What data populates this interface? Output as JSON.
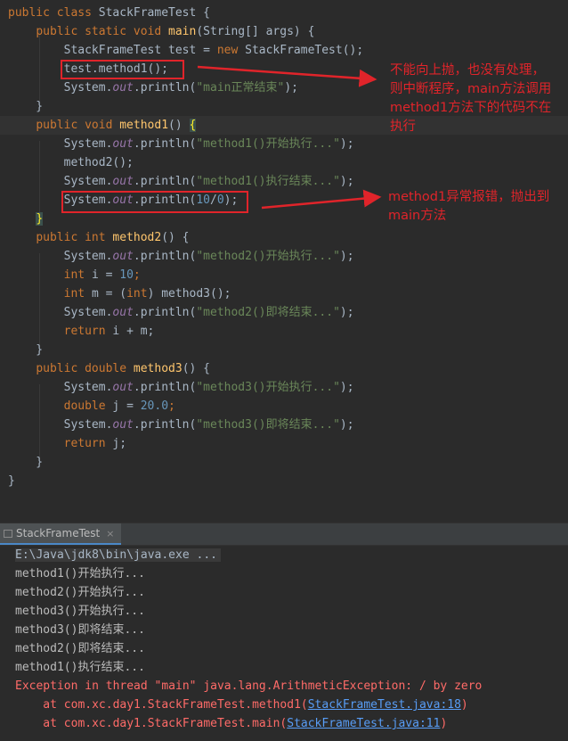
{
  "editor": {
    "lines": [
      [
        [
          "kw",
          "public class "
        ],
        [
          "",
          "StackFrameTest {"
        ]
      ],
      [
        [
          "",
          "    "
        ],
        [
          "kw",
          "public static void "
        ],
        [
          "fn",
          "main"
        ],
        [
          "",
          "(String[] args) {"
        ]
      ],
      [
        [
          "",
          "        StackFrameTest test = "
        ],
        [
          "kw",
          "new "
        ],
        [
          "",
          "StackFrameTest();"
        ]
      ],
      [
        [
          "",
          "        test.method1();"
        ]
      ],
      [
        [
          "",
          "        System."
        ],
        [
          "fld",
          "out"
        ],
        [
          "",
          ".println("
        ],
        [
          "str",
          "\"main正常结束\""
        ],
        [
          "",
          ");"
        ]
      ],
      [
        [
          "",
          "    }"
        ]
      ],
      [
        [
          "",
          "    "
        ],
        [
          "kw",
          "public void "
        ],
        [
          "fn",
          "method1"
        ],
        [
          "",
          "() "
        ],
        [
          "brm",
          "{"
        ]
      ],
      [
        [
          "",
          "        System."
        ],
        [
          "fld",
          "out"
        ],
        [
          "",
          ".println("
        ],
        [
          "str",
          "\"method1()开始执行...\""
        ],
        [
          "",
          ");"
        ]
      ],
      [
        [
          "",
          "        method2();"
        ]
      ],
      [
        [
          "",
          "        System."
        ],
        [
          "fld",
          "out"
        ],
        [
          "",
          ".println("
        ],
        [
          "str",
          "\"method1()执行结束...\""
        ],
        [
          "",
          ");"
        ]
      ],
      [
        [
          "",
          "        System."
        ],
        [
          "fld",
          "out"
        ],
        [
          "",
          ".println("
        ],
        [
          "num",
          "10"
        ],
        [
          "",
          "/"
        ],
        [
          "num",
          "0"
        ],
        [
          "",
          ");"
        ]
      ],
      [
        [
          "",
          "    "
        ],
        [
          "brm",
          "}"
        ]
      ],
      [
        [
          "",
          "    "
        ],
        [
          "kw",
          "public int "
        ],
        [
          "fn",
          "method2"
        ],
        [
          "",
          "() {"
        ]
      ],
      [
        [
          "",
          "        System."
        ],
        [
          "fld",
          "out"
        ],
        [
          "",
          ".println("
        ],
        [
          "str",
          "\"method2()开始执行...\""
        ],
        [
          "",
          ");"
        ]
      ],
      [
        [
          "",
          "        "
        ],
        [
          "kw",
          "int "
        ],
        [
          "",
          "i = "
        ],
        [
          "num",
          "10"
        ],
        [
          "kw",
          ";"
        ]
      ],
      [
        [
          "",
          "        "
        ],
        [
          "kw",
          "int "
        ],
        [
          "",
          "m = ("
        ],
        [
          "kw",
          "int"
        ],
        [
          "",
          ") method3();"
        ]
      ],
      [
        [
          "",
          "        System."
        ],
        [
          "fld",
          "out"
        ],
        [
          "",
          ".println("
        ],
        [
          "str",
          "\"method2()即将结束...\""
        ],
        [
          "",
          ");"
        ]
      ],
      [
        [
          "",
          "        "
        ],
        [
          "kw",
          "return "
        ],
        [
          "",
          "i + m;"
        ]
      ],
      [
        [
          "",
          "    }"
        ]
      ],
      [
        [
          "",
          "    "
        ],
        [
          "kw",
          "public double "
        ],
        [
          "fn",
          "method3"
        ],
        [
          "",
          "() {"
        ]
      ],
      [
        [
          "",
          "        System."
        ],
        [
          "fld",
          "out"
        ],
        [
          "",
          ".println("
        ],
        [
          "str",
          "\"method3()开始执行...\""
        ],
        [
          "",
          ");"
        ]
      ],
      [
        [
          "",
          "        "
        ],
        [
          "kw",
          "double "
        ],
        [
          "",
          "j = "
        ],
        [
          "num",
          "20.0"
        ],
        [
          "kw",
          ";"
        ]
      ],
      [
        [
          "",
          "        System."
        ],
        [
          "fld",
          "out"
        ],
        [
          "",
          ".println("
        ],
        [
          "str",
          "\"method3()即将结束...\""
        ],
        [
          "",
          ");"
        ]
      ],
      [
        [
          "",
          "        "
        ],
        [
          "kw",
          "return "
        ],
        [
          "",
          "j;"
        ]
      ],
      [
        [
          "",
          "    }"
        ]
      ],
      [
        [
          "",
          "}"
        ]
      ]
    ]
  },
  "annotations": {
    "note1": "不能向上抛，也没有处理，\n则中断程序，main方法调用\nmethod1方法下的代码不在\n执行",
    "note2": "method1异常报错，抛出到\nmain方法"
  },
  "run_panel": {
    "tab_label": "StackFrameTest",
    "close_glyph": "×",
    "command": "E:\\Java\\jdk8\\bin\\java.exe ...",
    "output": [
      "method1()开始执行...",
      "method2()开始执行...",
      "method3()开始执行...",
      "method3()即将结束...",
      "method2()即将结束...",
      "method1()执行结束..."
    ],
    "exception": "Exception in thread \"main\" java.lang.ArithmeticException: / by zero",
    "stack": [
      {
        "prefix": "    at com.xc.day1.StackFrameTest.method1(",
        "link": "StackFrameTest.java:18",
        "suffix": ")"
      },
      {
        "prefix": "    at com.xc.day1.StackFrameTest.main(",
        "link": "StackFrameTest.java:11",
        "suffix": ")"
      }
    ]
  },
  "colors": {
    "background": "#2b2b2b",
    "keyword": "#cc7832",
    "method_name": "#ffc66d",
    "string": "#6a8759",
    "number": "#6897bb",
    "static_field": "#9876aa",
    "error_text": "#ff6b68",
    "annotation_red": "#e0242a",
    "link": "#589df6"
  }
}
